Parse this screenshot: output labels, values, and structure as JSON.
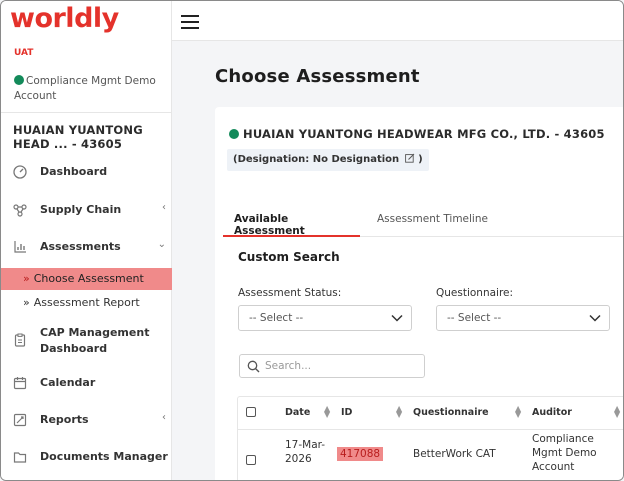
{
  "brand": {
    "logo": "worldly",
    "env": "UAT"
  },
  "account": "Compliance Mgmt Demo Account",
  "supplier_short": "HUAIAN YUANTONG HEAD ... - 43605",
  "nav": {
    "dashboard": "Dashboard",
    "supply_chain": "Supply Chain",
    "assessments": "Assessments",
    "choose_assessment": "Choose Assessment",
    "assessment_report": "Assessment Report",
    "cap_line1": "CAP Management",
    "cap_line2": "Dashboard",
    "calendar": "Calendar",
    "reports": "Reports",
    "documents": "Documents Manager"
  },
  "page": {
    "title": "Choose Assessment"
  },
  "supplier": {
    "name": "HUAIAN YUANTONG HEADWEAR MFG CO., LTD. - 43605",
    "designation_prefix": "(Designation: No Designation",
    "designation_suffix": ")"
  },
  "tabs": {
    "available": "Available Assessment",
    "timeline": "Assessment Timeline"
  },
  "custom_search": {
    "title": "Custom Search",
    "status_label": "Assessment Status:",
    "status_value": "-- Select --",
    "questionnaire_label": "Questionnaire:",
    "questionnaire_value": "-- Select --",
    "search_placeholder": "Search..."
  },
  "table": {
    "headers": {
      "date": "Date",
      "id": "ID",
      "questionnaire": "Questionnaire",
      "auditor": "Auditor"
    },
    "rows": [
      {
        "date_line1": "17-Mar-",
        "date_line2": "2026",
        "id": "417088",
        "questionnaire": "BetterWork CAT",
        "auditor_line1": "Compliance",
        "auditor_line2": "Mgmt Demo",
        "auditor_line3": "Account"
      }
    ]
  },
  "colors": {
    "brand": "#e4322b",
    "active_bg": "#f08a8a",
    "status_dot": "#138a5a"
  },
  "icons": [
    "dashboard-icon",
    "supply-chain-icon",
    "assessments-icon",
    "cap-icon",
    "calendar-icon",
    "reports-icon",
    "folder-icon",
    "hamburger-icon",
    "search-icon",
    "edit-icon",
    "chevron-down-icon"
  ]
}
